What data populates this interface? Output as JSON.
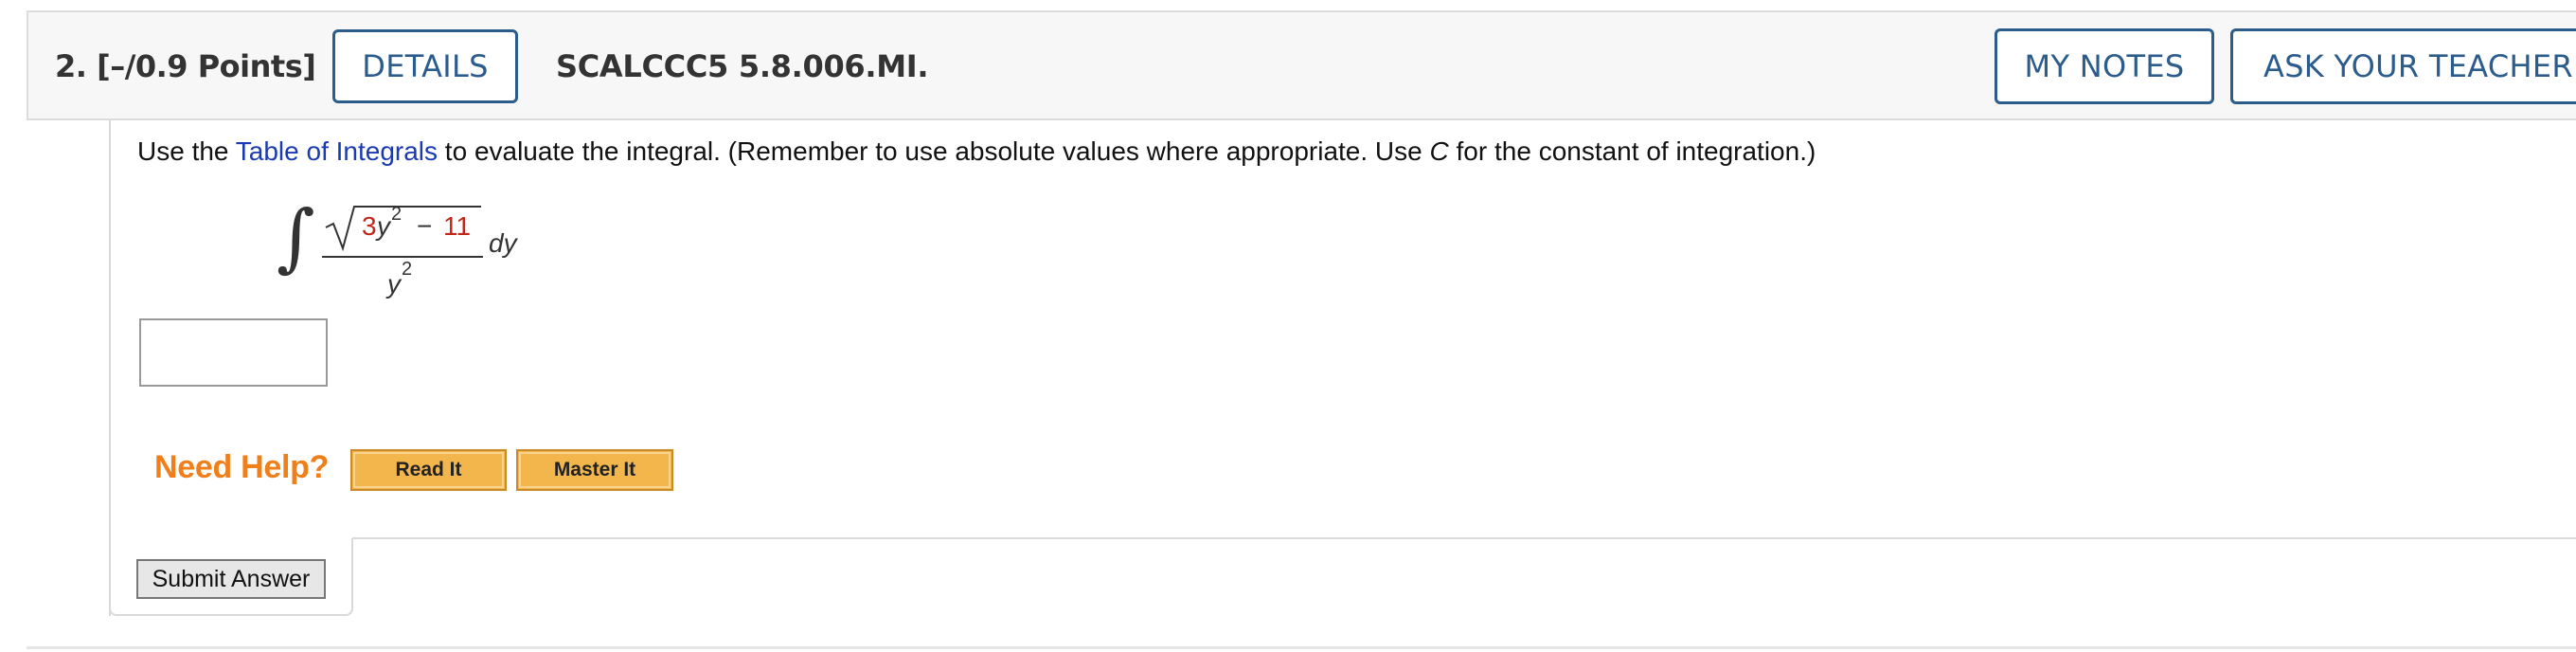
{
  "header": {
    "question_points": "2.  [–/0.9 Points]",
    "details_label": "DETAILS",
    "problem_code": "SCALCCC5 5.8.006.MI.",
    "my_notes_label": "MY NOTES",
    "ask_teacher_label": "ASK YOUR TEACHER"
  },
  "question": {
    "prompt_before_link": "Use the ",
    "link_text": "Table of Integrals",
    "prompt_middle": " to evaluate the integral. (Remember to use absolute values where appropriate. Use ",
    "constant_var": "C",
    "prompt_after": " for the constant of integration.)",
    "integral": {
      "sign": "∫",
      "coef": "3",
      "var": "y",
      "exp": "2",
      "minus": "−",
      "const": "11",
      "den_var": "y",
      "den_exp": "2",
      "differential": "dy"
    },
    "answer_value": ""
  },
  "help": {
    "label": "Need Help?",
    "read_it": "Read It",
    "master_it": "Master It"
  },
  "submit_label": "Submit Answer",
  "colors": {
    "accent_blue": "#2b5c8c",
    "link_blue": "#1a3ab2",
    "need_help_orange": "#ef7f1a",
    "red_value": "#c0261a"
  }
}
